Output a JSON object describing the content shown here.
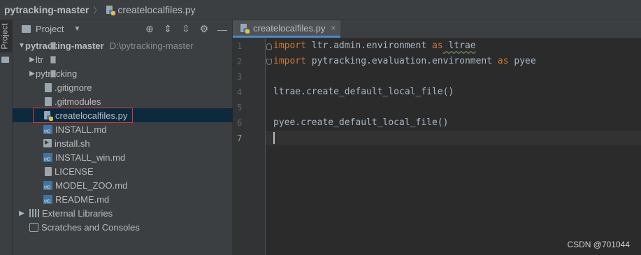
{
  "breadcrumb": {
    "project": "pytracking-master",
    "separator": "〉",
    "file": "createlocalfiles.py"
  },
  "left_strip": {
    "label": "Project"
  },
  "project_panel": {
    "title": "Project",
    "tree": [
      {
        "label": "pytracking-master",
        "path": "D:\\pytracking-master",
        "icon": "folder-icon",
        "expander": "▼"
      },
      {
        "label": "ltr",
        "icon": "folder-icon",
        "expander": "▶"
      },
      {
        "label": "pytracking",
        "icon": "folder-icon",
        "expander": "▶"
      },
      {
        "label": ".gitignore",
        "icon": "git-file-icon"
      },
      {
        "label": ".gitmodules",
        "icon": "git-file-icon"
      },
      {
        "label": "createlocalfiles.py",
        "icon": "python-file-icon",
        "selected": true
      },
      {
        "label": "INSTALL.md",
        "icon": "markdown-file-icon"
      },
      {
        "label": "install.sh",
        "icon": "shell-file-icon"
      },
      {
        "label": "INSTALL_win.md",
        "icon": "markdown-file-icon"
      },
      {
        "label": "LICENSE",
        "icon": "text-file-icon"
      },
      {
        "label": "MODEL_ZOO.md",
        "icon": "markdown-file-icon"
      },
      {
        "label": "README.md",
        "icon": "markdown-file-icon"
      },
      {
        "label": "External Libraries",
        "icon": "library-icon",
        "expander": "▶"
      },
      {
        "label": "Scratches and Consoles",
        "icon": "scratches-icon"
      }
    ]
  },
  "editor": {
    "tab": {
      "name": "createlocalfiles.py",
      "close": "×"
    },
    "line_numbers": [
      "1",
      "2",
      "3",
      "4",
      "5",
      "6",
      "7"
    ],
    "lines": [
      {
        "kw": "import",
        "text": " ltr.admin.environment ",
        "kw2": "as",
        "alias": " ltrae"
      },
      {
        "kw": "import",
        "text": " pytracking.evaluation.environment ",
        "kw2": "as",
        "alias": " pyee"
      },
      {
        "text": ""
      },
      {
        "text": "ltrae.create_default_local_file()"
      },
      {
        "text": ""
      },
      {
        "text": "pyee.create_default_local_file()"
      },
      {
        "text": ""
      }
    ]
  },
  "watermark": "CSDN @701044",
  "colors": {
    "keyword": "#cc7832",
    "selection": "#0d293e",
    "accent": "#4a88c7",
    "highlight_box": "#d53a3a"
  }
}
